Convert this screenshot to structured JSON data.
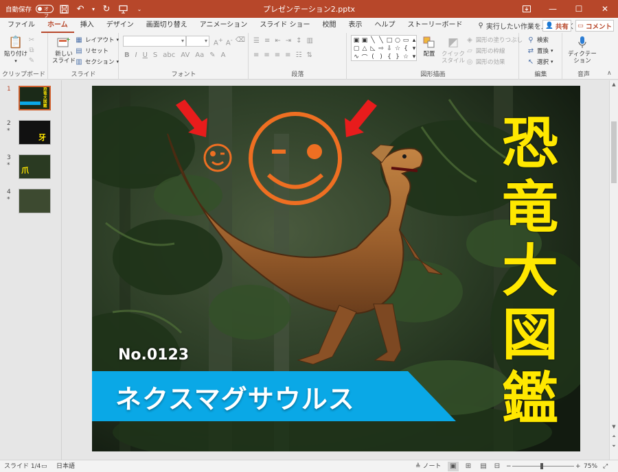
{
  "titlebar": {
    "autosave_label": "自動保存",
    "autosave_state": "オフ",
    "document_title": "プレゼンテーション2.pptx",
    "bg_color": "#b7472a"
  },
  "tabs": [
    {
      "label": "ファイル",
      "active": false
    },
    {
      "label": "ホーム",
      "active": true
    },
    {
      "label": "挿入",
      "active": false
    },
    {
      "label": "デザイン",
      "active": false
    },
    {
      "label": "画面切り替え",
      "active": false
    },
    {
      "label": "アニメーション",
      "active": false
    },
    {
      "label": "スライド ショー",
      "active": false
    },
    {
      "label": "校閲",
      "active": false
    },
    {
      "label": "表示",
      "active": false
    },
    {
      "label": "ヘルプ",
      "active": false
    },
    {
      "label": "ストーリーボード",
      "active": false
    }
  ],
  "tell_me": "実行したい作業を入力してください",
  "share_label": "共有",
  "comment_label": "コメント",
  "ribbon": {
    "clipboard": {
      "label": "クリップボード",
      "paste": "貼り付け"
    },
    "slides": {
      "label": "スライド",
      "new_slide_1": "新しい",
      "new_slide_2": "スライド",
      "layout": "レイアウト",
      "reset": "リセット",
      "section": "セクション"
    },
    "font": {
      "label": "フォント"
    },
    "paragraph": {
      "label": "段落"
    },
    "drawing": {
      "label": "図形描画",
      "arrange": "配置",
      "quick_style_1": "クイック",
      "quick_style_2": "スタイル",
      "fill": "図形の塗りつぶし",
      "outline": "図形の枠線",
      "effects": "図形の効果"
    },
    "editing": {
      "label": "編集",
      "find": "検索",
      "replace": "置換",
      "select": "選択"
    },
    "voice": {
      "label": "音声",
      "dictate_1": "ディクテー",
      "dictate_2": "ション"
    }
  },
  "thumbnails": [
    {
      "number": "1",
      "star": "",
      "caption": "恐竜大図鑑",
      "active": true
    },
    {
      "number": "2",
      "star": "*",
      "caption": "牙",
      "active": false
    },
    {
      "number": "3",
      "star": "*",
      "caption": "爪",
      "active": false
    },
    {
      "number": "4",
      "star": "*",
      "caption": "",
      "active": false
    }
  ],
  "slide": {
    "title_chars": [
      "恐",
      "竜",
      "大",
      "図",
      "鑑"
    ],
    "dino_number": "No.0123",
    "dino_name": "ネクスマグサウルス",
    "title_color": "#ffe800",
    "band_color": "#0aa8e6",
    "smiley_color": "#ee6f22",
    "arrow_color": "#e81c1c"
  },
  "statusbar": {
    "slide_info": "スライド 1/4",
    "language": "日本語",
    "notes": "ノート",
    "zoom": "75%"
  }
}
